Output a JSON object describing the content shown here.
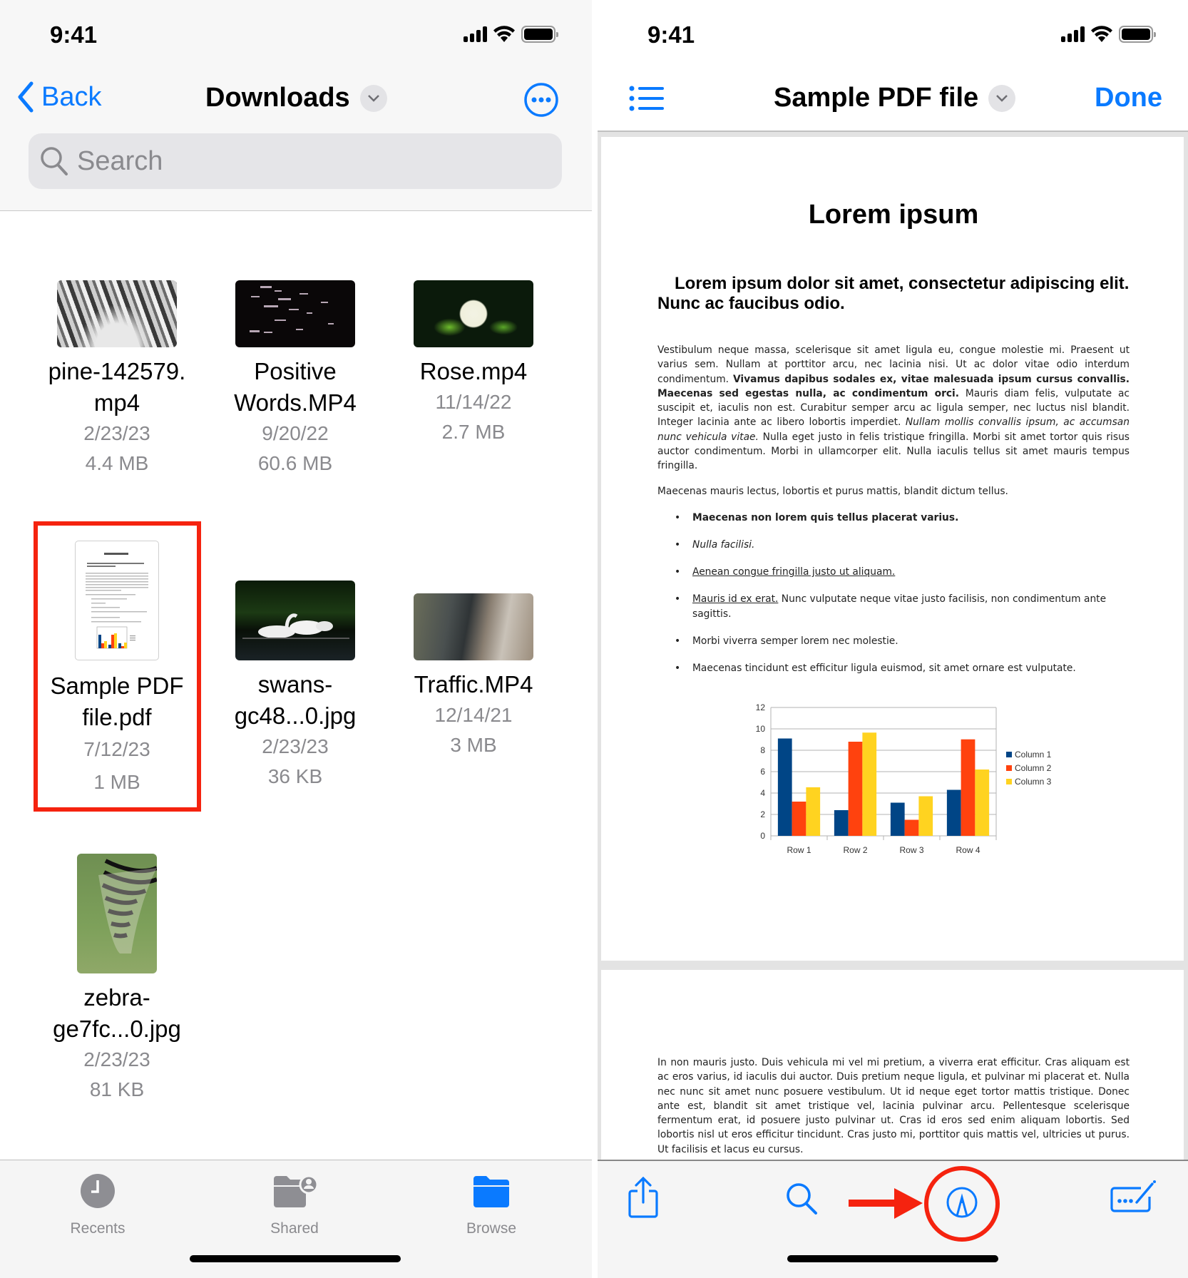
{
  "status_bar": {
    "time": "9:41"
  },
  "files_app": {
    "back_label": "Back",
    "title": "Downloads",
    "search_placeholder": "Search",
    "items": [
      {
        "name_line1": "pine-142579.",
        "name_line2": "mp4",
        "date": "2/23/23",
        "size": "4.4 MB",
        "kind": "video",
        "selected": false
      },
      {
        "name_line1": "Positive",
        "name_line2": "Words.MP4",
        "date": "9/20/22",
        "size": "60.6 MB",
        "kind": "video",
        "selected": false
      },
      {
        "name_line1": "Rose.mp4",
        "name_line2": "",
        "date": "11/14/22",
        "size": "2.7 MB",
        "kind": "video",
        "selected": false
      },
      {
        "name_line1": "Sample PDF",
        "name_line2": "file.pdf",
        "date": "7/12/23",
        "size": "1 MB",
        "kind": "pdf",
        "selected": true
      },
      {
        "name_line1": "swans-",
        "name_line2": "gc48...0.jpg",
        "date": "2/23/23",
        "size": "36 KB",
        "kind": "image",
        "selected": false
      },
      {
        "name_line1": "Traffic.MP4",
        "name_line2": "",
        "date": "12/14/21",
        "size": "3 MB",
        "kind": "video",
        "selected": false
      },
      {
        "name_line1": "zebra-",
        "name_line2": "ge7fc...0.jpg",
        "date": "2/23/23",
        "size": "81 KB",
        "kind": "image",
        "selected": false
      }
    ],
    "tabs": [
      {
        "label": "Recents",
        "icon": "clock-icon",
        "active": false
      },
      {
        "label": "Shared",
        "icon": "shared-folder-icon",
        "active": false
      },
      {
        "label": "Browse",
        "icon": "folder-icon",
        "active": true
      }
    ]
  },
  "pdf_viewer": {
    "title": "Sample PDF file",
    "done_label": "Done",
    "document": {
      "heading": "Lorem ipsum",
      "subheading": "Lorem ipsum dolor sit amet, consectetur adipiscing elit. Nunc ac faucibus odio.",
      "para1_a": "Vestibulum neque massa, scelerisque sit amet ligula eu, congue molestie mi. Praesent ut varius sem. Nullam at porttitor arcu, nec lacinia nisi. Ut ac dolor vitae odio interdum condimentum. ",
      "para1_bold": "Vivamus dapibus sodales ex, vitae malesuada ipsum cursus convallis. Maecenas sed egestas nulla, ac condimentum orci.",
      "para1_b": " Mauris diam felis, vulputate ac suscipit et, iaculis non est. Curabitur semper arcu ac ligula semper, nec luctus nisl blandit. Integer lacinia ante ac libero lobortis imperdiet. ",
      "para1_italic": "Nullam mollis convallis ipsum, ac accumsan nunc vehicula vitae.",
      "para1_c": " Nulla eget justo in felis tristique fringilla. Morbi sit amet tortor quis risus auctor condimentum. Morbi in ullamcorper elit. Nulla iaculis tellus sit amet mauris tempus fringilla.",
      "para2": "Maecenas mauris lectus, lobortis et purus mattis, blandit dictum tellus.",
      "bullets": {
        "b1": "Maecenas non lorem quis tellus placerat varius.",
        "b2": "Nulla facilisi.",
        "b3": "Aenean congue fringilla justo ut aliquam.",
        "b4_underlined": "Mauris id ex erat.",
        "b4_rest": " Nunc vulputate neque vitae justo facilisis, non condimentum ante sagittis.",
        "b5": "Morbi viverra semper lorem nec molestie.",
        "b6": "Maecenas tincidunt est efficitur ligula euismod, sit amet ornare est vulputate."
      },
      "page2_para": "In non mauris justo. Duis vehicula mi vel mi pretium, a viverra erat efficitur. Cras aliquam est ac eros varius, id iaculis dui auctor. Duis pretium neque ligula, et pulvinar mi placerat et. Nulla nec nunc sit amet nunc posuere vestibulum. Ut id neque eget tortor mattis tristique. Donec ante est, blandit sit amet tristique vel, lacinia pulvinar arcu. Pellentesque scelerisque fermentum erat, id posuere justo pulvinar ut. Cras id eros sed enim aliquam lobortis. Sed lobortis nisl ut eros efficitur tincidunt. Cras justo mi, porttitor quis mattis vel, ultricies ut purus. Ut facilisis et lacus eu cursus."
    },
    "toolbar": [
      "share-icon",
      "search-icon",
      "markup-icon",
      "form-fill-icon"
    ]
  },
  "chart_data": {
    "type": "bar",
    "title": "",
    "xlabel": "",
    "ylabel": "",
    "categories": [
      "Row 1",
      "Row 2",
      "Row 3",
      "Row 4"
    ],
    "series": [
      {
        "name": "Column 1",
        "color": "#004586",
        "values": [
          9.1,
          2.4,
          3.1,
          4.3
        ]
      },
      {
        "name": "Column 2",
        "color": "#ff420e",
        "values": [
          3.2,
          8.8,
          1.5,
          9.02
        ]
      },
      {
        "name": "Column 3",
        "color": "#ffd320",
        "values": [
          4.54,
          9.65,
          3.7,
          6.2
        ]
      }
    ],
    "yticks": [
      "0",
      "2",
      "4",
      "6",
      "8",
      "10",
      "12"
    ],
    "ylim": [
      0,
      12
    ],
    "grid": true,
    "legend": "right"
  },
  "colors": {
    "accent": "#0a7aff",
    "annotation_red": "#f5230f"
  }
}
